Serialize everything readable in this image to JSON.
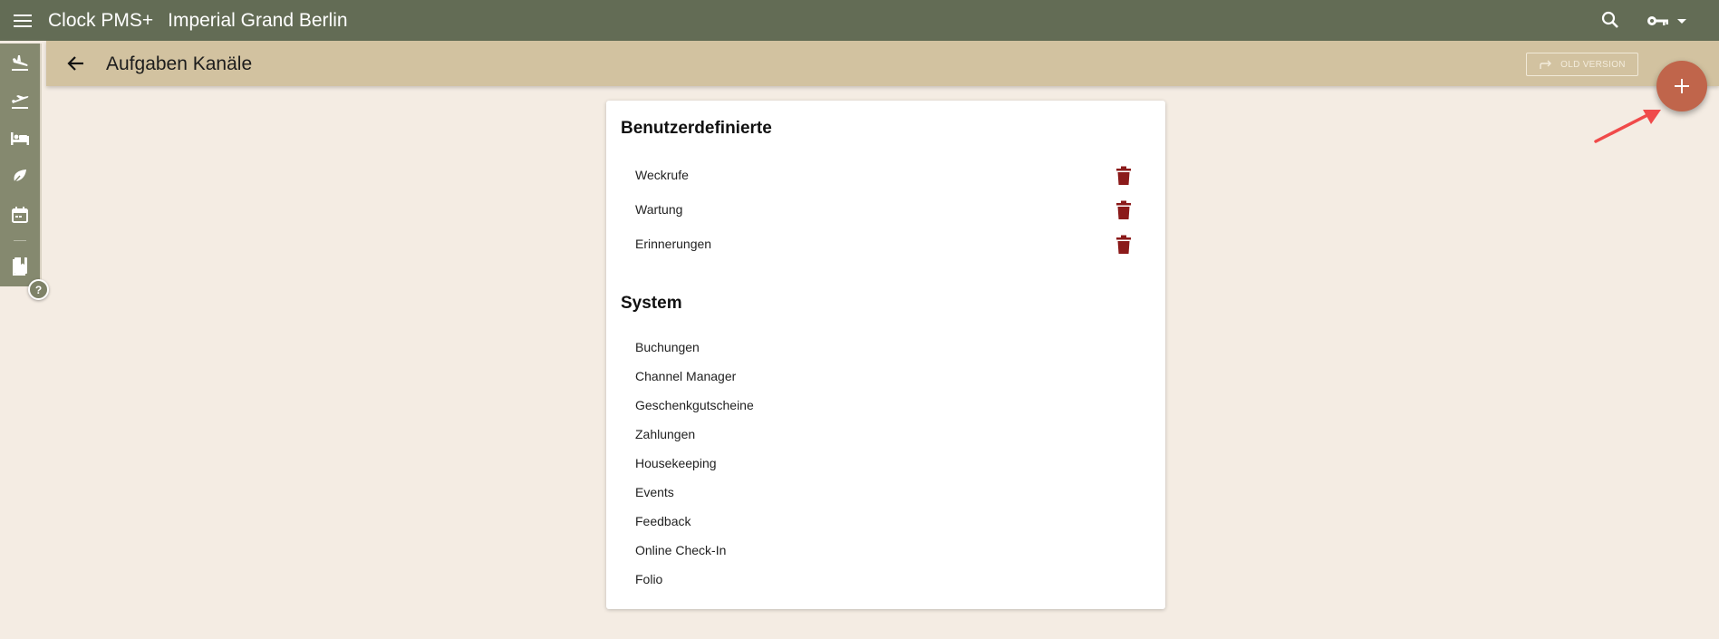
{
  "topbar": {
    "menu_icon": "hamburger-icon",
    "app_title": "Clock PMS+",
    "hotel_title": "Imperial Grand Berlin",
    "search_icon": "search-icon",
    "key_icon": "key-icon"
  },
  "siderail": {
    "items": [
      {
        "icon": "airplane-arrival-icon"
      },
      {
        "icon": "airplane-departure-icon"
      },
      {
        "icon": "bed-icon"
      },
      {
        "icon": "leaf-icon"
      },
      {
        "icon": "calendar-icon"
      },
      {
        "icon": "book-icon"
      }
    ],
    "help_label": "?"
  },
  "subheader": {
    "title": "Aufgaben Kanäle",
    "old_version_label": "OLD VERSION"
  },
  "custom_section": {
    "heading": "Benutzerdefinierte",
    "items": [
      "Weckrufe",
      "Wartung",
      "Erinnerungen"
    ]
  },
  "system_section": {
    "heading": "System",
    "items": [
      "Buchungen",
      "Channel Manager",
      "Geschenkgutscheine",
      "Zahlungen",
      "Housekeeping",
      "Events",
      "Feedback",
      "Online Check-In",
      "Folio"
    ]
  },
  "colors": {
    "topbar": "#636c55",
    "subheader": "#d2c2a0",
    "fab": "#c0654b",
    "trash": "#8b1a1a",
    "annotation_arrow": "#f04a4a"
  }
}
